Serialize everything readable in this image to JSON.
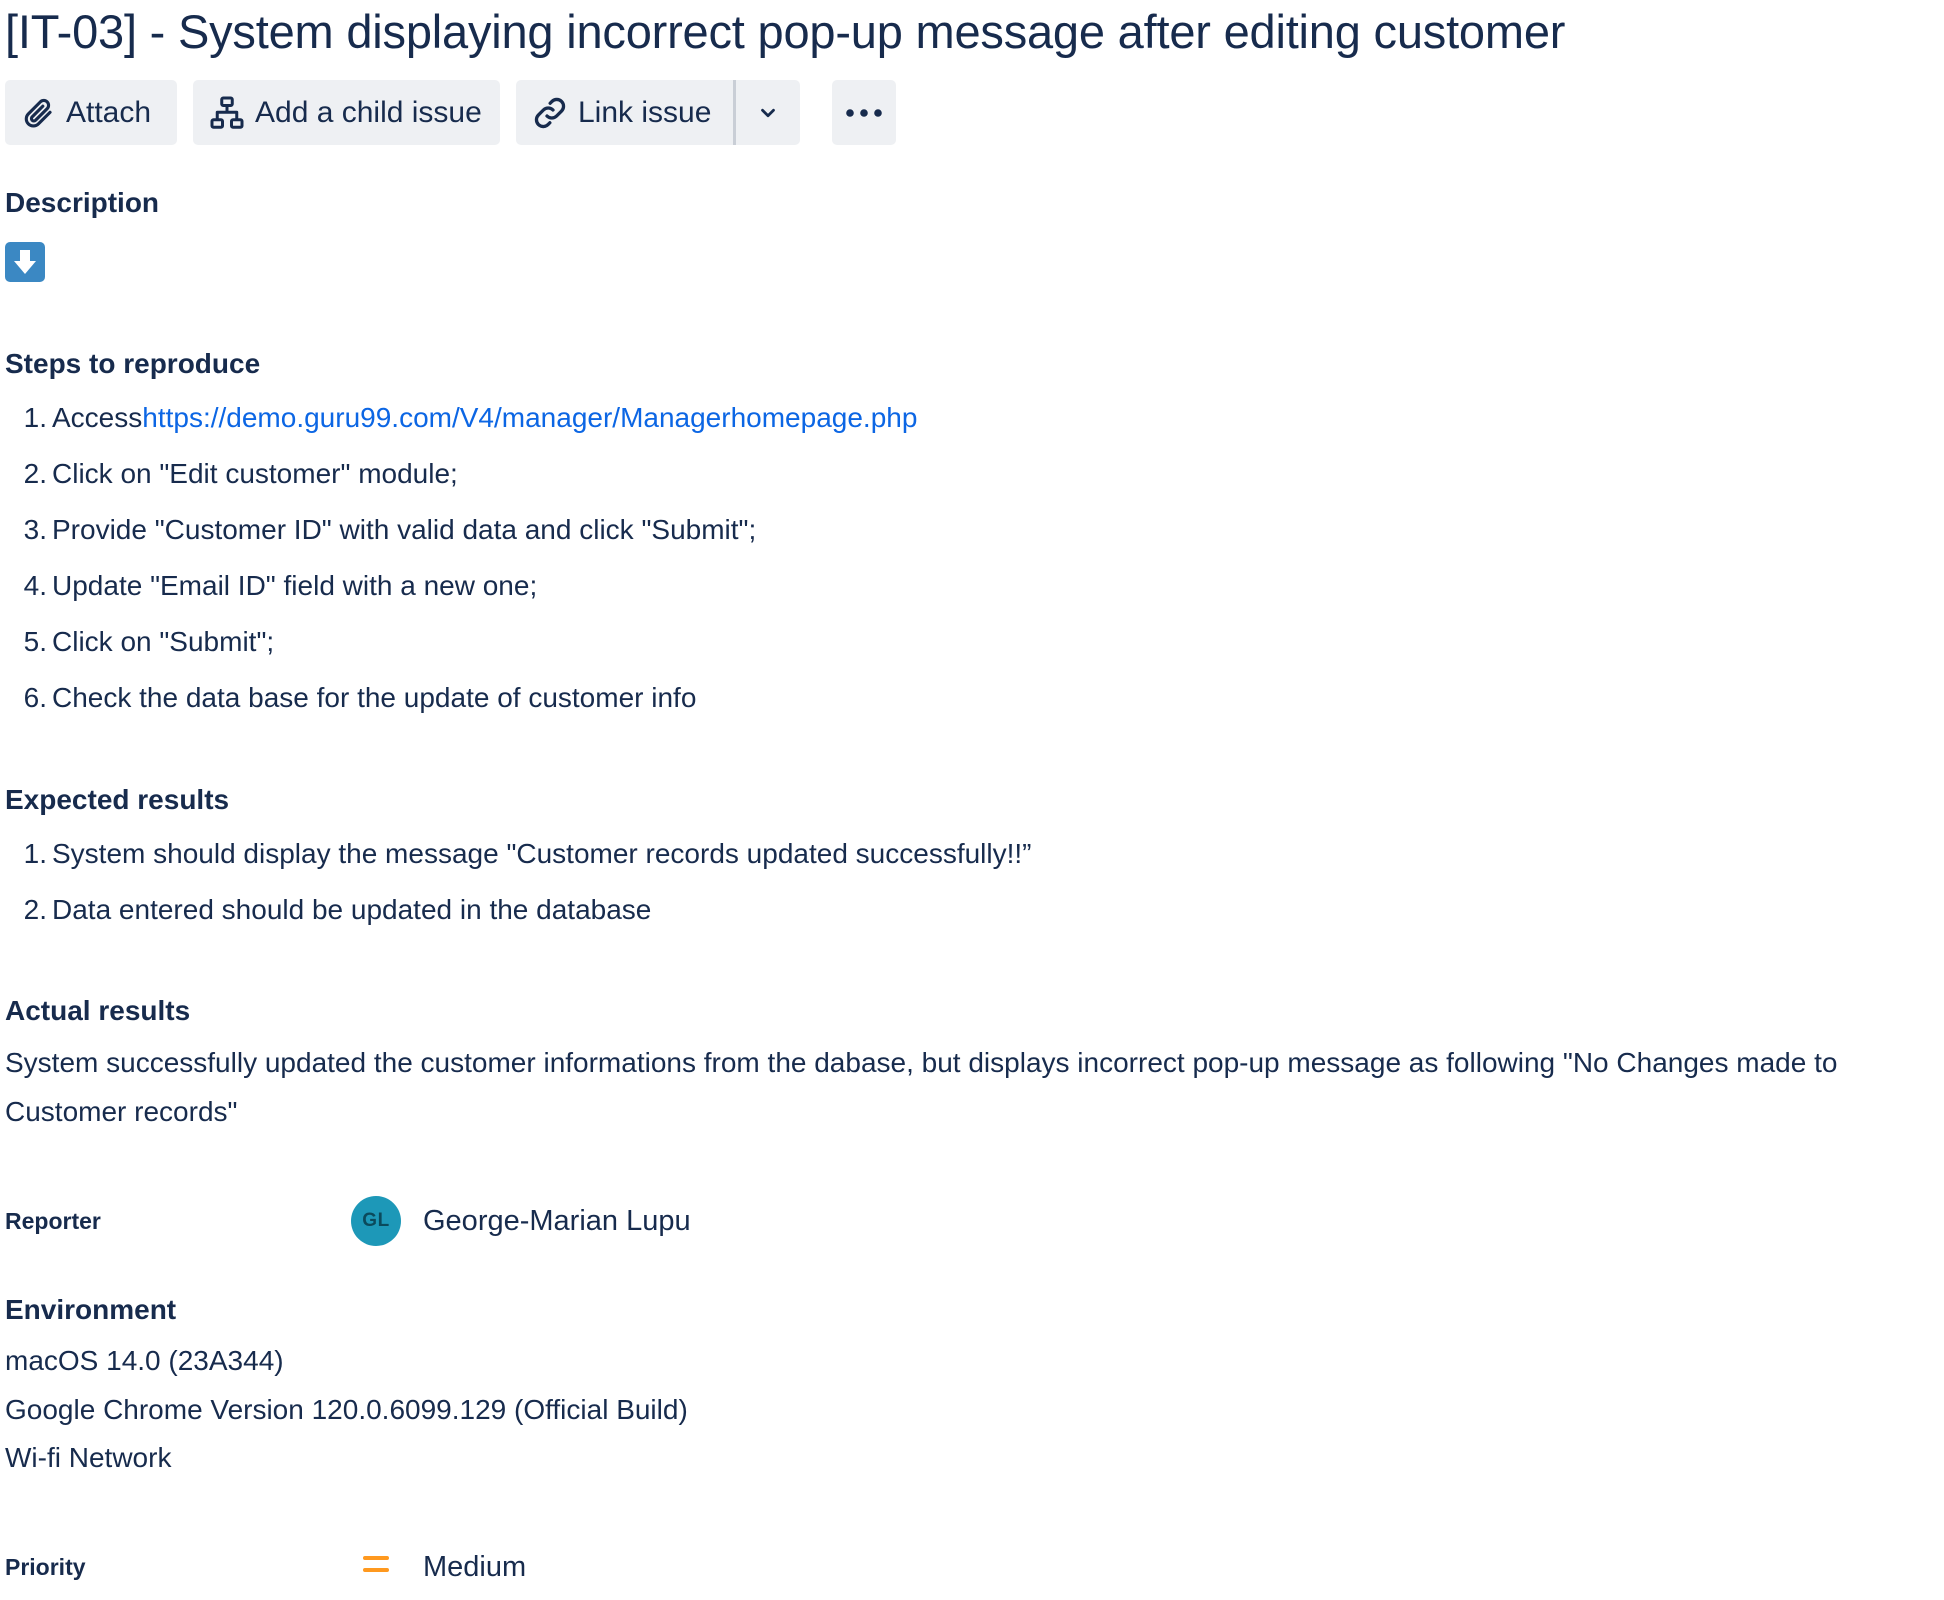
{
  "issue": {
    "title": "[IT-03] - System displaying incorrect pop-up message after editing customer"
  },
  "toolbar": {
    "attach_label": "Attach",
    "attach_icon": "paperclip-icon",
    "child_label": "Add a child issue",
    "child_icon": "hierarchy-icon",
    "link_label": "Link issue",
    "link_icon": "link-icon",
    "caret_icon": "chevron-down-icon",
    "more_icon": "more-horizontal-icon"
  },
  "description": {
    "heading": "Description",
    "emoji_icon": "arrow-down-emoji-icon",
    "steps_heading": "Steps to reproduce",
    "steps": [
      {
        "num": "1.",
        "text": "Access",
        "link": "https://demo.guru99.com/V4/manager/Managerhomepage.php"
      },
      {
        "num": "2.",
        "text": "Click on \"Edit customer\" module;"
      },
      {
        "num": "3.",
        "text": "Provide \"Customer ID\" with valid data and click \"Submit\";"
      },
      {
        "num": "4.",
        "text": "Update \"Email ID\" field with a new one;"
      },
      {
        "num": "5.",
        "text": "Click on \"Submit\";"
      },
      {
        "num": "6.",
        "text": "Check the data base for the update of customer info"
      }
    ],
    "expected_heading": "Expected results",
    "expected": [
      {
        "num": "1.",
        "text": "System should display the message \"Customer records updated successfully!!”"
      },
      {
        "num": "2.",
        "text": "Data entered should be updated in the database"
      }
    ],
    "actual_heading": "Actual results",
    "actual_lines": [
      "System successfully updated the customer informations from the dabase, but displays incorrect pop-up message as following \"No Changes made to",
      "Customer records\""
    ]
  },
  "reporter": {
    "label": "Reporter",
    "initials": "GL",
    "name": "George-Marian Lupu",
    "avatar_color": "#1d98b8"
  },
  "environment": {
    "heading": "Environment",
    "lines": [
      "macOS 14.0 (23A344)",
      "Google Chrome Version 120.0.6099.129 (Official Build)",
      "Wi-fi Network"
    ]
  },
  "priority": {
    "label": "Priority",
    "value": "Medium",
    "icon": "priority-medium-icon",
    "color": "#ff991f"
  },
  "colors": {
    "text": "#172b4d",
    "link": "#0c66e4",
    "button_bg": "#eef0f3"
  }
}
